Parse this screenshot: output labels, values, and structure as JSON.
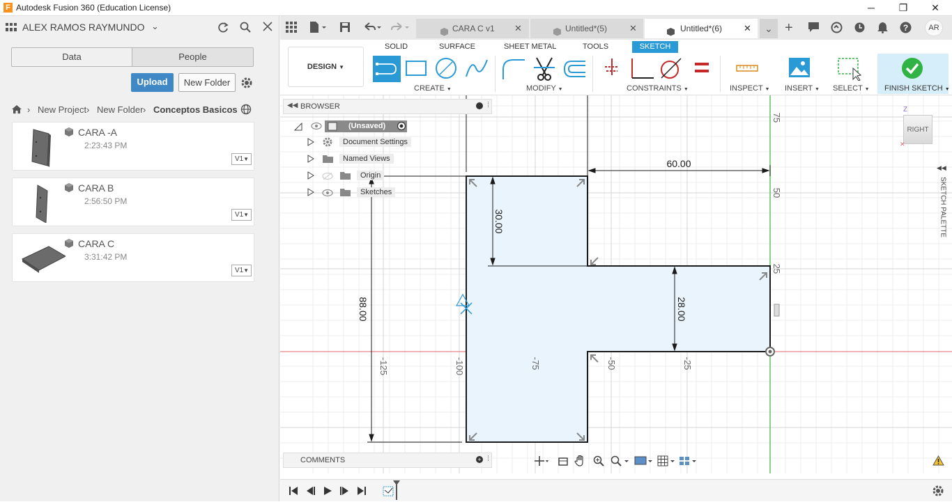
{
  "window": {
    "title": "Autodesk Fusion 360 (Education License)",
    "minimize": "─",
    "maximize": "❐",
    "close": "✕"
  },
  "user": {
    "name": "ALEX RAMOS RAYMUNDO"
  },
  "panel": {
    "tabs": [
      "Data",
      "People"
    ],
    "upload_label": "Upload",
    "new_folder_label": "New Folder",
    "breadcrumb": [
      "New Project",
      "New Folder",
      "Conceptos Basicos"
    ],
    "files": [
      {
        "name": "CARA -A",
        "time": "2:23:43 PM",
        "version": "V1"
      },
      {
        "name": "CARA B",
        "time": "2:56:50 PM",
        "version": "V1"
      },
      {
        "name": "CARA C",
        "time": "3:31:42 PM",
        "version": "V1"
      }
    ]
  },
  "tabs": [
    {
      "label": "CARA C v1"
    },
    {
      "label": "Untitled*(5)"
    },
    {
      "label": "Untitled*(6)"
    }
  ],
  "toolbar": {
    "workspace": "DESIGN",
    "tabs": [
      "SOLID",
      "SURFACE",
      "SHEET METAL",
      "TOOLS",
      "SKETCH"
    ],
    "groups": [
      "CREATE",
      "MODIFY",
      "CONSTRAINTS",
      "INSPECT",
      "INSERT",
      "SELECT",
      "FINISH SKETCH"
    ]
  },
  "browser": {
    "title": "BROWSER",
    "root": "(Unsaved)",
    "items": [
      "Document Settings",
      "Named Views",
      "Origin",
      "Sketches"
    ]
  },
  "comments": {
    "title": "COMMENTS"
  },
  "viewcube": {
    "face": "RIGHT",
    "axis": "Z"
  },
  "sketch_palette": {
    "label": "SKETCH PALETTE"
  },
  "sketch": {
    "dimensions": [
      "60.00",
      "30.00",
      "28.00",
      "88.00"
    ],
    "axis_ticks_x": [
      "-125",
      "-100",
      "-75",
      "-50",
      "-25"
    ],
    "axis_ticks_y": [
      "75",
      "50",
      "25"
    ]
  },
  "colors": {
    "accent": "#2a9ad6",
    "upload": "#3f88c5",
    "finish": "#2fb344",
    "x_axis": "#e06666",
    "y_axis": "#5cc45c"
  }
}
